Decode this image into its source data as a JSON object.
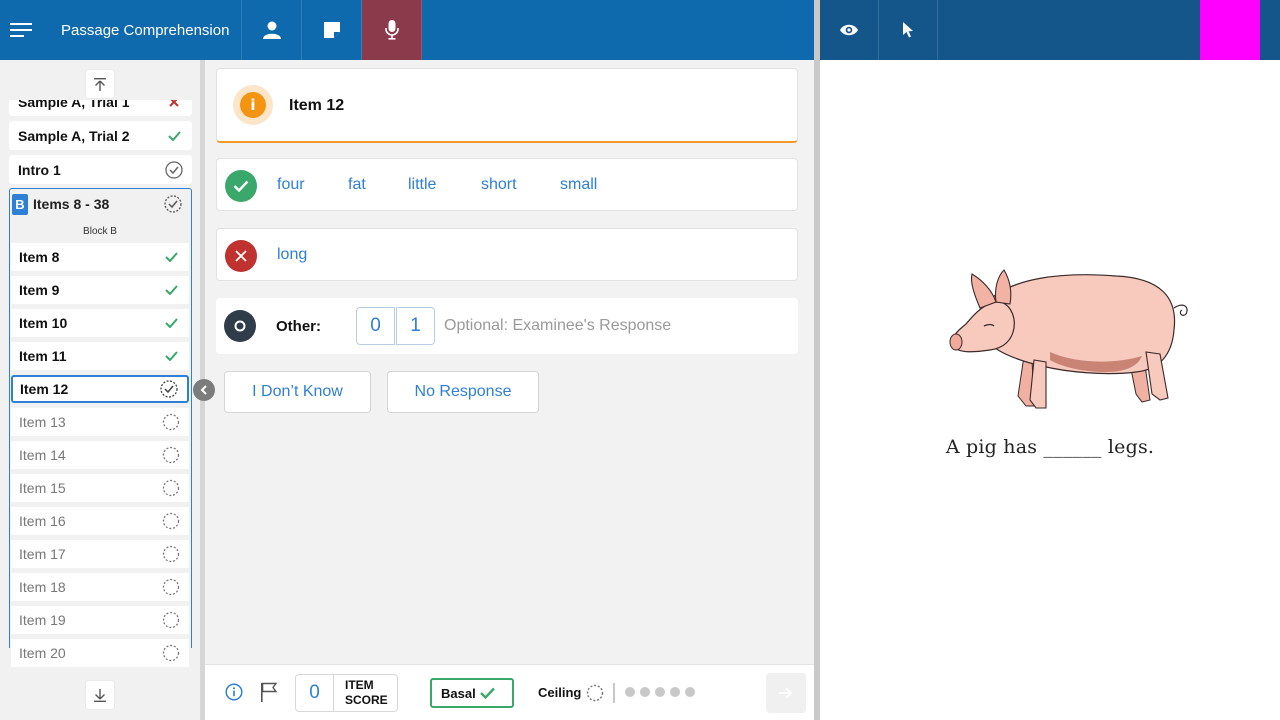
{
  "app": {
    "title": "Passage Comprehension"
  },
  "sidebar": {
    "items_before_block": [
      {
        "label": "Sample A, Trial 1",
        "status": "incorrect"
      },
      {
        "label": "Sample A, Trial 2",
        "status": "correct"
      },
      {
        "label": "Intro 1",
        "status": "done"
      }
    ],
    "block": {
      "badge": "B",
      "title": "Items 8 - 38",
      "subtitle": "Block B",
      "items": [
        {
          "label": "Item 8",
          "status": "correct"
        },
        {
          "label": "Item 9",
          "status": "correct"
        },
        {
          "label": "Item 10",
          "status": "correct"
        },
        {
          "label": "Item 11",
          "status": "correct"
        },
        {
          "label": "Item 12",
          "status": "current"
        },
        {
          "label": "Item 13",
          "status": "pending"
        },
        {
          "label": "Item 14",
          "status": "pending"
        },
        {
          "label": "Item 15",
          "status": "pending"
        },
        {
          "label": "Item 16",
          "status": "pending"
        },
        {
          "label": "Item 17",
          "status": "pending"
        },
        {
          "label": "Item 18",
          "status": "pending"
        },
        {
          "label": "Item 19",
          "status": "pending"
        },
        {
          "label": "Item 20",
          "status": "pending"
        }
      ]
    }
  },
  "item": {
    "title": "Item 12",
    "correct_words": [
      "four",
      "fat",
      "little",
      "short",
      "small"
    ],
    "incorrect_words": [
      "long"
    ],
    "other_label": "Other:",
    "score_options": [
      "0",
      "1"
    ],
    "response_placeholder": "Optional: Examinee's Response",
    "dont_know_label": "I Don’t Know",
    "no_response_label": "No Response"
  },
  "bottom": {
    "item_score_value": "0",
    "item_score_label_line1": "ITEM",
    "item_score_label_line2": "SCORE",
    "basal_label": "Basal",
    "ceiling_label": "Ceiling",
    "ceiling_dot_count": 5
  },
  "stimulus": {
    "sentence": "A pig has ______ legs."
  },
  "colors": {
    "topbar": "#0f6aad",
    "topbar_right": "#14568a",
    "mic_active": "#8a3a4a",
    "accent_blue": "#2e7fd6",
    "correct_green": "#3aa86b",
    "incorrect_red": "#c0322f",
    "info_orange": "#f39513",
    "magenta": "#ff00ff"
  },
  "icons": {
    "menu": "hamburger-menu-icon",
    "person": "person-icon",
    "note": "note-icon",
    "mic": "microphone-icon",
    "eye": "eye-icon",
    "cursor": "pointer-cursor-icon"
  }
}
